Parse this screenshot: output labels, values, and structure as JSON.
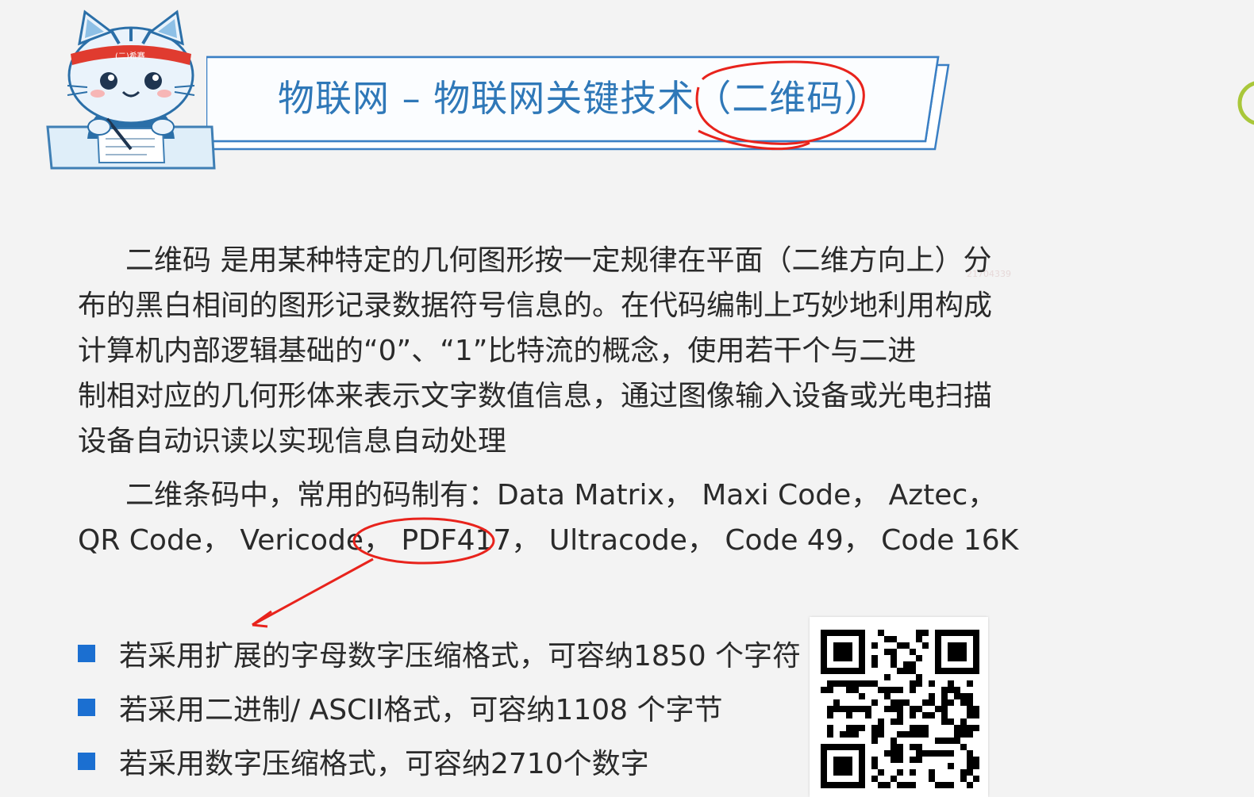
{
  "title": "物联网 – 物联网关键技术（二维码）",
  "mascot": {
    "headband_text": "(二)希赛"
  },
  "watermark": "21704339",
  "paragraph1": {
    "lines": [
      "二维码 是用某种特定的几何图形按一定规律在平面（二维方向上）分",
      "布的黑白相间的图形记录数据符号信息的。在代码编制上巧妙地利用构成",
      "计算机内部逻辑基础的“0”、“1”比特流的概念，使用若干个与二进",
      "制相对应的几何形体来表示文字数值信息，通过图像输入设备或光电扫描",
      "设备自动识读以实现信息自动处理"
    ]
  },
  "paragraph2": {
    "lines": [
      "二维条码中，常用的码制有：Data Matrix， Maxi Code， Aztec，",
      "QR Code， Vericode， PDF417， Ultracode， Code 49， Code 16K"
    ]
  },
  "bullets": [
    "若采用扩展的字母数字压缩格式，可容纳1850 个字符",
    "若采用二进制/ ASCII格式，可容纳1108 个字节",
    "若采用数字压缩格式，可容纳2710个数字"
  ],
  "colors": {
    "title": "#2f78b8",
    "bullet_square": "#1b6fd1",
    "annotation_red": "#e8231c",
    "banner_border": "#3a7fc4"
  },
  "icons": {
    "mascot": "cat-mascot-icon",
    "qr": "qr-code-icon"
  }
}
